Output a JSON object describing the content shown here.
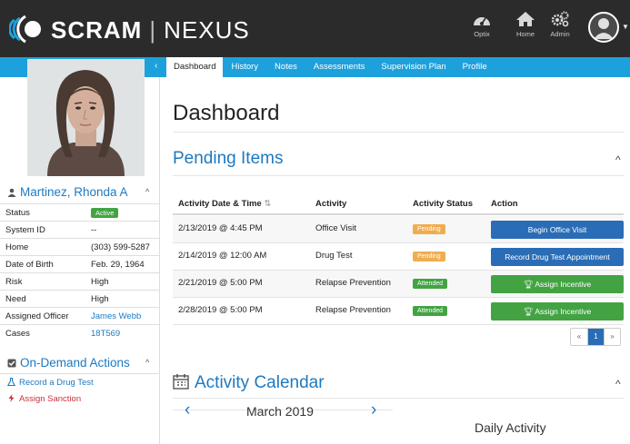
{
  "brand": {
    "name_part1": "SCRAM",
    "separator": "|",
    "name_part2": "NEXUS"
  },
  "topnav": [
    {
      "label": "Optix",
      "icon": "dashboard-gauge-icon"
    },
    {
      "label": "Home",
      "icon": "home-icon"
    },
    {
      "label": "Admin",
      "icon": "gears-icon"
    }
  ],
  "tabs": [
    "Dashboard",
    "History",
    "Notes",
    "Assessments",
    "Supervision Plan",
    "Profile"
  ],
  "active_tab": "Dashboard",
  "person": {
    "name": "Martinez, Rhonda A",
    "fields": [
      {
        "key": "Status",
        "value": "Active",
        "type": "badge"
      },
      {
        "key": "System ID",
        "value": "--"
      },
      {
        "key": "Home",
        "value": "(303) 599-5287"
      },
      {
        "key": "Date of Birth",
        "value": "Feb. 29, 1964"
      },
      {
        "key": "Risk",
        "value": "High"
      },
      {
        "key": "Need",
        "value": "High"
      },
      {
        "key": "Assigned Officer",
        "value": "James Webb",
        "type": "link"
      },
      {
        "key": "Cases",
        "value": "18T569",
        "type": "link"
      }
    ]
  },
  "on_demand": {
    "title": "On-Demand Actions",
    "items": [
      "Record a Drug Test",
      "Assign Sanction"
    ]
  },
  "page_title": "Dashboard",
  "pending": {
    "title": "Pending Items",
    "columns": [
      "Activity Date & Time",
      "Activity",
      "Activity Status",
      "Action"
    ],
    "rows": [
      {
        "date": "2/13/2019 @ 4:45 PM",
        "activity": "Office Visit",
        "status": "Pending",
        "action": "Begin Office Visit"
      },
      {
        "date": "2/14/2019 @ 12:00 AM",
        "activity": "Drug Test",
        "status": "Pending",
        "action": "Record Drug Test Appointment"
      },
      {
        "date": "2/21/2019 @ 5:00 PM",
        "activity": "Relapse Prevention",
        "status": "Attended",
        "action": "Assign Incentive"
      },
      {
        "date": "2/28/2019 @ 5:00 PM",
        "activity": "Relapse Prevention",
        "status": "Attended",
        "action": "Assign Incentive"
      }
    ],
    "pager": {
      "prev": "«",
      "current": "1",
      "next": "»"
    }
  },
  "calendar": {
    "title": "Activity Calendar",
    "month": "March 2019",
    "prev": "‹",
    "next": "›",
    "daily_title": "Daily Activity"
  },
  "colors": {
    "topbar": "#2b2b2b",
    "accent_blue": "#1da1dc",
    "link_blue": "#1d79c1",
    "button_blue": "#2a6db6",
    "green": "#43a343",
    "orange": "#f0ad4e"
  }
}
